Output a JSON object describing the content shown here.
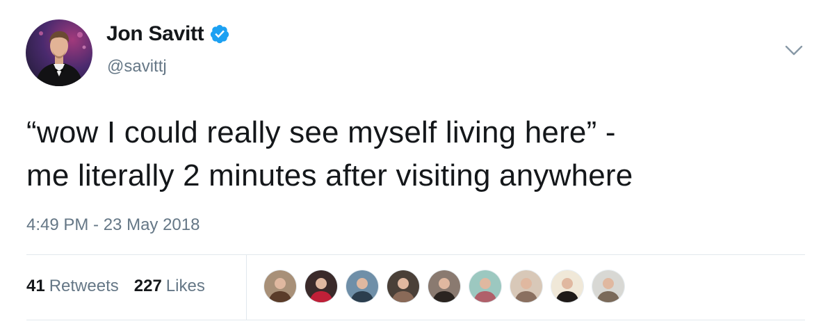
{
  "tweet": {
    "author": {
      "display_name": "Jon Savitt",
      "handle": "@savittj",
      "verified": true,
      "avatar_icon": "profile-photo-icon"
    },
    "text_lines": [
      "“wow I could really see myself living here” -",
      "me literally 2 minutes after visiting anywhere"
    ],
    "timestamp": "4:49 PM - 23 May 2018",
    "stats": {
      "retweets": {
        "count": "41",
        "label": "Retweets"
      },
      "likes": {
        "count": "227",
        "label": "Likes"
      }
    },
    "likers": [
      {
        "icon": "liker-avatar-1",
        "bg": "#a89078",
        "fg": "#5a3c2a"
      },
      {
        "icon": "liker-avatar-2",
        "bg": "#3a2a2a",
        "fg": "#c02038"
      },
      {
        "icon": "liker-avatar-3",
        "bg": "#6f8fa8",
        "fg": "#2c3e4e"
      },
      {
        "icon": "liker-avatar-4",
        "bg": "#4a4038",
        "fg": "#8a6a58"
      },
      {
        "icon": "liker-avatar-5",
        "bg": "#8a7a70",
        "fg": "#2a2420"
      },
      {
        "icon": "liker-avatar-6",
        "bg": "#9cc8c0",
        "fg": "#b0606a"
      },
      {
        "icon": "liker-avatar-7",
        "bg": "#d8c8b8",
        "fg": "#8a7060"
      },
      {
        "icon": "liker-avatar-8",
        "bg": "#f0e8d8",
        "fg": "#1e1a18"
      },
      {
        "icon": "liker-avatar-9",
        "bg": "#d8d8d4",
        "fg": "#7a6a5a"
      }
    ],
    "colors": {
      "text": "#14171a",
      "secondary": "#657786",
      "verified_blue": "#1da1f2",
      "divider": "#e1e8ed"
    }
  }
}
